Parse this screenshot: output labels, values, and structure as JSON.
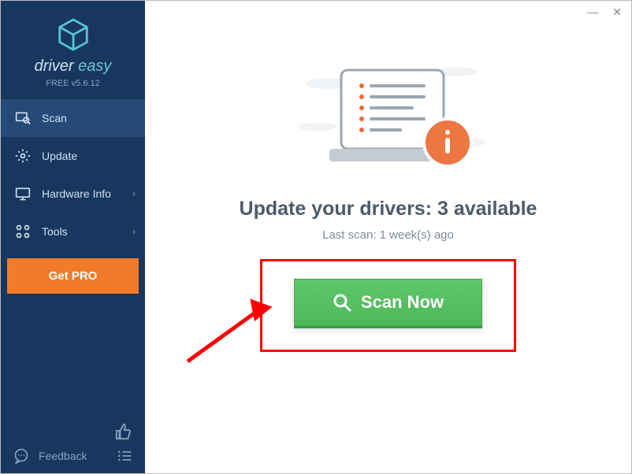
{
  "window": {
    "minimize": "—",
    "close": "✕"
  },
  "brand": {
    "name1": "driver",
    "name2": " easy",
    "version": "FREE v5.6.12"
  },
  "nav": {
    "scan": "Scan",
    "update": "Update",
    "hardware": "Hardware Info",
    "tools": "Tools"
  },
  "getPro": "Get PRO",
  "feedback": "Feedback",
  "main": {
    "headingPrefix": "Update your drivers: ",
    "headingCount": "3 available",
    "lastScan": "Last scan: 1 week(s) ago",
    "scanBtn": "Scan Now"
  }
}
